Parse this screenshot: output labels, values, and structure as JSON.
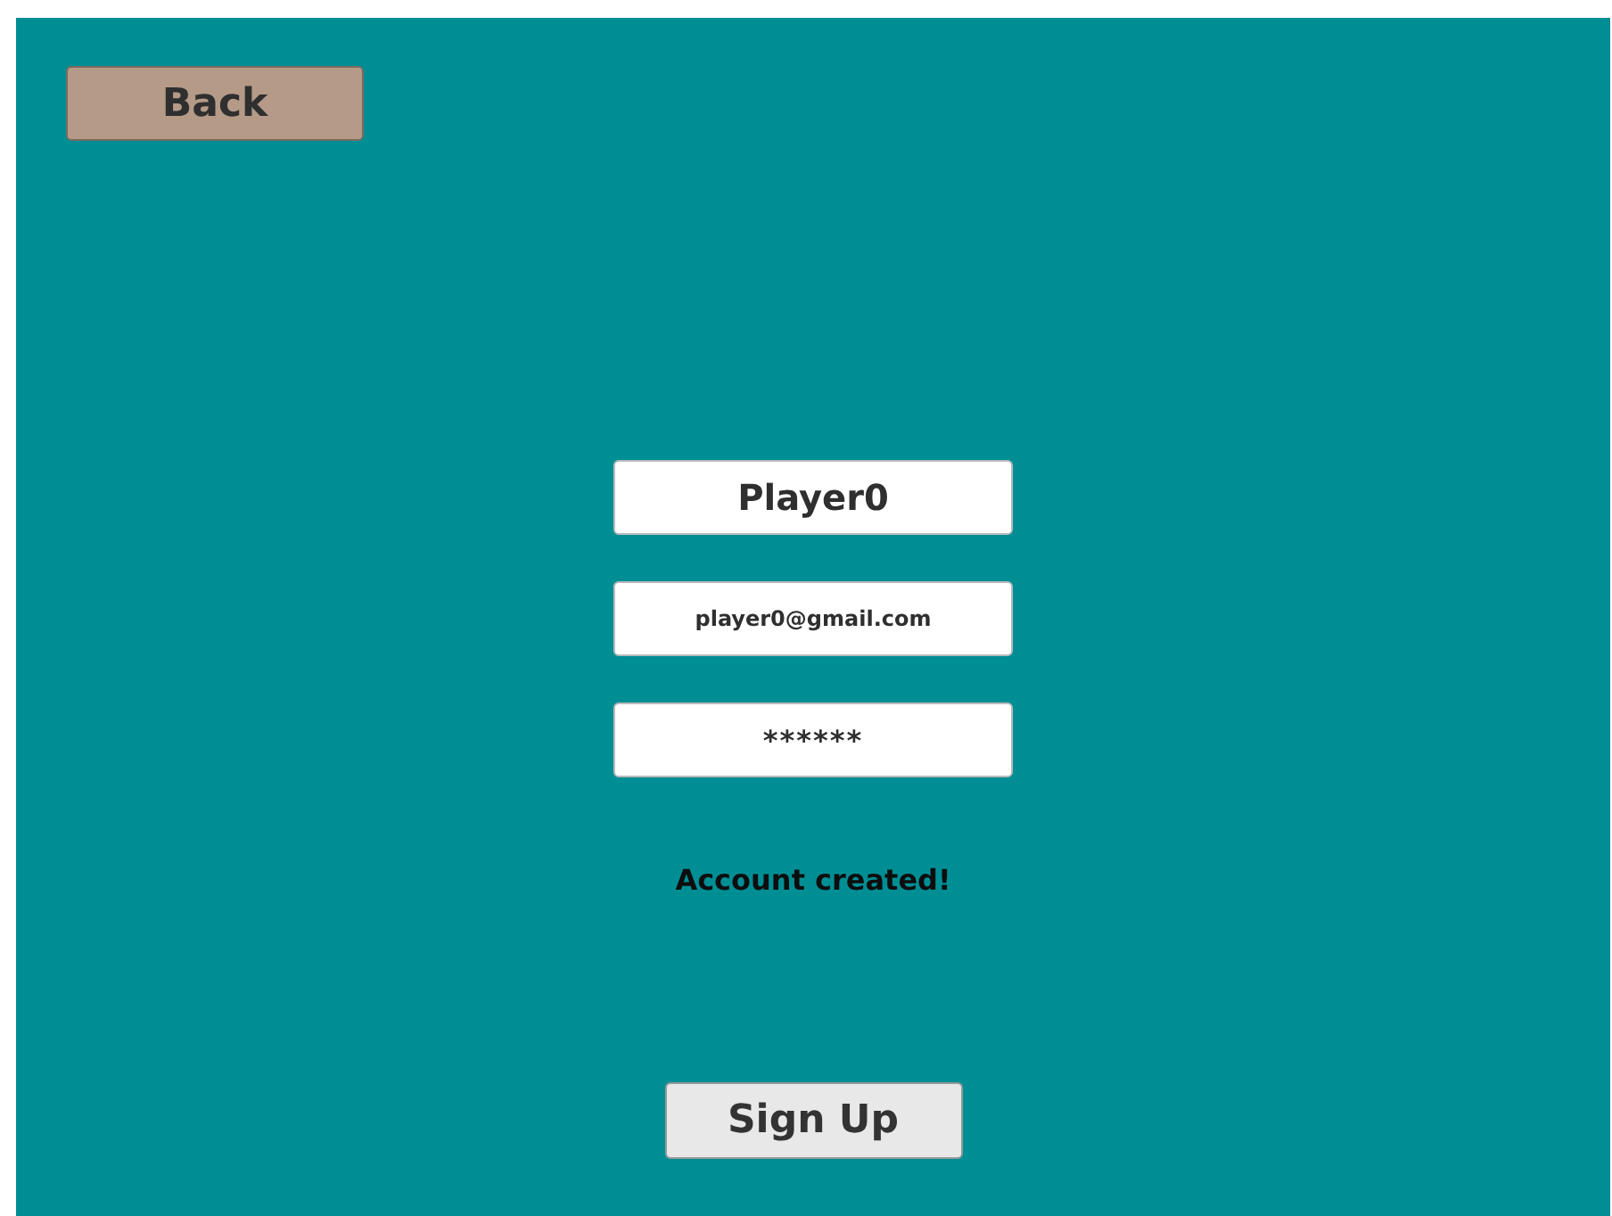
{
  "back_button": {
    "label": "Back"
  },
  "fields": [
    {
      "kind": "username",
      "value": "Player0"
    },
    {
      "kind": "email",
      "value": "player0@gmail.com"
    },
    {
      "kind": "password",
      "value": "******"
    }
  ],
  "message": "Account created!",
  "signup_button": {
    "label": "Sign Up"
  }
}
